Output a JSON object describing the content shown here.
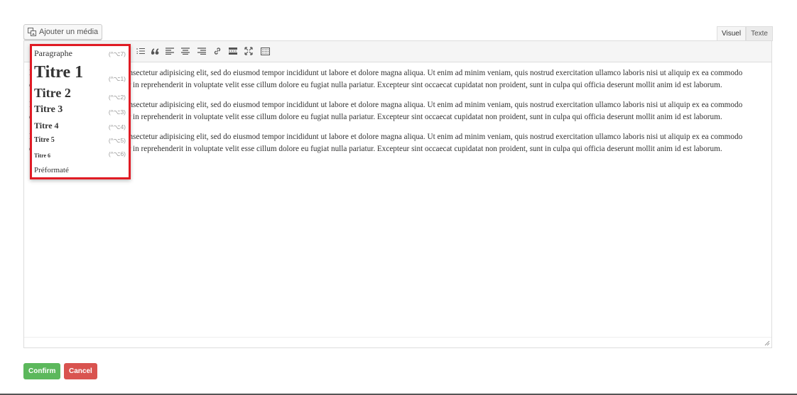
{
  "media_button": {
    "label": "Ajouter un média",
    "icon": "media-icon"
  },
  "tabs": [
    {
      "label": "Visuel",
      "active": true
    },
    {
      "label": "Texte",
      "active": false
    }
  ],
  "toolbar": {
    "icons": [
      "bulleted-list-icon",
      "numbered-list-icon",
      "blockquote-icon",
      "align-left-icon",
      "align-center-icon",
      "align-right-icon",
      "link-icon",
      "more-tag-icon",
      "fullscreen-icon",
      "toolbar-toggle-icon"
    ]
  },
  "content": {
    "paragraphs": [
      "Lorem ipsum dolor sit amet, consectetur adipisicing elit, sed do eiusmod tempor incididunt ut labore et dolore magna aliqua. Ut enim ad minim veniam, quis nostrud exercitation ullamco laboris nisi ut aliquip ex ea commodo consequat. Duis aute irure dolor in reprehenderit in voluptate velit esse cillum dolore eu fugiat nulla pariatur. Excepteur sint occaecat cupidatat non proident, sunt in culpa qui officia deserunt mollit anim id est laborum.",
      "Lorem ipsum dolor sit amet, consectetur adipisicing elit, sed do eiusmod tempor incididunt ut labore et dolore magna aliqua. Ut enim ad minim veniam, quis nostrud exercitation ullamco laboris nisi ut aliquip ex ea commodo consequat. Duis aute irure dolor in reprehenderit in voluptate velit esse cillum dolore eu fugiat nulla pariatur. Excepteur sint occaecat cupidatat non proident, sunt in culpa qui officia deserunt mollit anim id est laborum.",
      "Lorem ipsum dolor sit amet, consectetur adipisicing elit, sed do eiusmod tempor incididunt ut labore et dolore magna aliqua. Ut enim ad minim veniam, quis nostrud exercitation ullamco laboris nisi ut aliquip ex ea commodo consequat. Duis aute irure dolor in reprehenderit in voluptate velit esse cillum dolore eu fugiat nulla pariatur. Excepteur sint occaecat cupidatat non proident, sunt in culpa qui officia deserunt mollit anim id est laborum."
    ]
  },
  "format_dropdown": {
    "items": [
      {
        "label": "Paragraphe",
        "shortcut": "(^⌥7)"
      },
      {
        "label": "Titre 1",
        "shortcut": "(^⌥1)"
      },
      {
        "label": "Titre 2",
        "shortcut": "(^⌥2)"
      },
      {
        "label": "Titre 3",
        "shortcut": "(^⌥3)"
      },
      {
        "label": "Titre 4",
        "shortcut": "(^⌥4)"
      },
      {
        "label": "Titre 5",
        "shortcut": "(^⌥5)"
      },
      {
        "label": "Titre 6",
        "shortcut": "(^⌥6)"
      },
      {
        "label": "Préformaté",
        "shortcut": ""
      }
    ],
    "highlight_color": "#e01b24"
  },
  "actions": {
    "confirm_label": "Confirm",
    "cancel_label": "Cancel"
  },
  "colors": {
    "confirm": "#5cb85c",
    "cancel": "#d9534f"
  }
}
